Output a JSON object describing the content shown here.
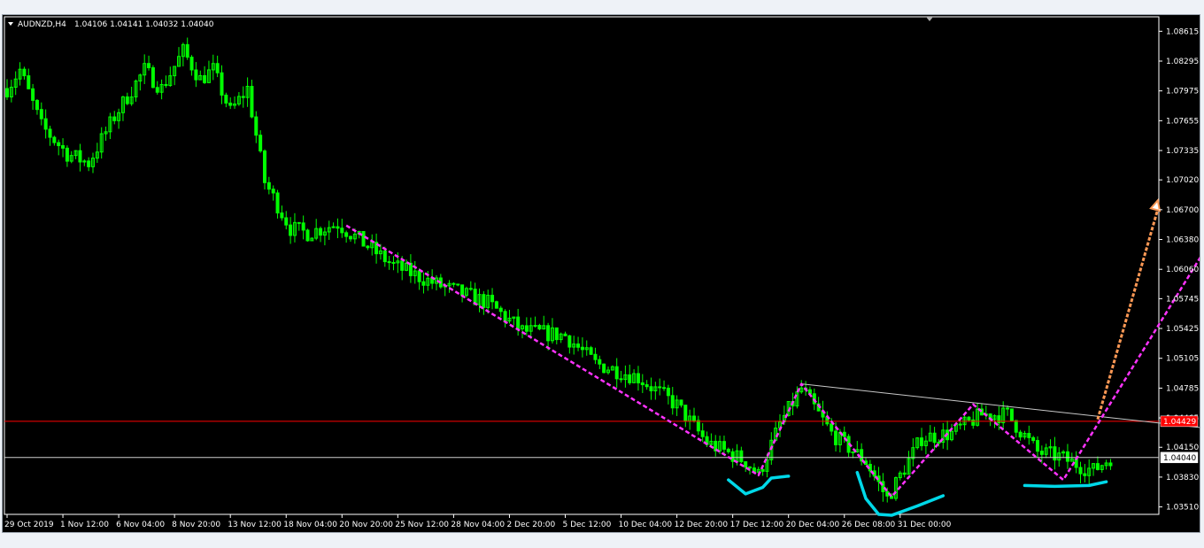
{
  "chart_data": {
    "type": "candlestick",
    "symbol_header": "AUDNZD,H4",
    "ohlc_header": "1.04106 1.04141 1.04032 1.04040",
    "y_ticks": [
      "1.08615",
      "1.08295",
      "1.07975",
      "1.07655",
      "1.07335",
      "1.07020",
      "1.06700",
      "1.06380",
      "1.06060",
      "1.05745",
      "1.05425",
      "1.05105",
      "1.04785",
      "1.04465",
      "1.04150",
      "1.03830",
      "1.03510"
    ],
    "ylim": [
      1.0343,
      1.0877
    ],
    "x_ticks": [
      "29 Oct 2019",
      "1 Nov 12:00",
      "6 Nov 04:00",
      "8 Nov 20:00",
      "13 Nov 12:00",
      "18 Nov 04:00",
      "20 Nov 20:00",
      "25 Nov 12:00",
      "28 Nov 04:00",
      "2 Dec 20:00",
      "5 Dec 12:00",
      "10 Dec 04:00",
      "12 Dec 20:00",
      "17 Dec 12:00",
      "20 Dec 04:00",
      "26 Dec 08:00",
      "31 Dec 00:00"
    ],
    "price_profile": [
      [
        0,
        1.08
      ],
      [
        3,
        1.082
      ],
      [
        8,
        1.076
      ],
      [
        14,
        1.073
      ],
      [
        19,
        1.072
      ],
      [
        25,
        1.077
      ],
      [
        32,
        1.082
      ],
      [
        36,
        1.08
      ],
      [
        41,
        1.084
      ],
      [
        45,
        1.081
      ],
      [
        48,
        1.082
      ],
      [
        52,
        1.0775
      ],
      [
        56,
        1.08
      ],
      [
        60,
        1.07
      ],
      [
        66,
        1.065
      ],
      [
        70,
        1.0645
      ],
      [
        77,
        1.0655
      ],
      [
        90,
        1.061
      ],
      [
        100,
        1.059
      ],
      [
        112,
        1.057
      ],
      [
        120,
        1.054
      ],
      [
        130,
        1.0535
      ],
      [
        137,
        1.0505
      ],
      [
        147,
        1.049
      ],
      [
        156,
        1.046
      ],
      [
        163,
        1.042
      ],
      [
        172,
        1.04
      ],
      [
        175,
        1.0385
      ],
      [
        180,
        1.044
      ],
      [
        185,
        1.0478
      ],
      [
        192,
        1.043
      ],
      [
        200,
        1.04
      ],
      [
        205,
        1.036
      ],
      [
        213,
        1.0425
      ],
      [
        220,
        1.043
      ],
      [
        227,
        1.045
      ],
      [
        233,
        1.045
      ],
      [
        240,
        1.041
      ],
      [
        245,
        1.0405
      ],
      [
        250,
        1.0395
      ],
      [
        253,
        1.039
      ],
      [
        257,
        1.0404
      ]
    ],
    "bars": 258,
    "current_price": 1.0404,
    "current_price_label": "1.04040",
    "red_level": 1.04429,
    "red_level_label": "1.04429",
    "colors": {
      "background": "#000000",
      "candles": "#00ff00",
      "text": "#ffffff",
      "red_line": "#ff0000",
      "white_line": "#c8c8c8",
      "annotation_magenta": "#ff33ff",
      "annotation_arrow": "#ff9955",
      "annotation_cyan": "#00d8e8"
    },
    "annotations": {
      "trendline": {
        "color": "#ffffff",
        "points": [
          [
            185,
            1.0483
          ],
          [
            310,
            1.042
          ]
        ]
      },
      "magenta_dashed": [
        [
          79,
          1.0653
        ],
        [
          175,
          1.0385
        ],
        [
          185,
          1.0483
        ],
        [
          206,
          1.0362
        ],
        [
          225,
          1.0461
        ],
        [
          246,
          1.038
        ],
        [
          279,
          1.0627
        ]
      ],
      "arrow": {
        "from": [
          254,
          1.0445
        ],
        "to": [
          268,
          1.068
        ]
      },
      "cyan_strokes": [
        [
          [
            168,
            1.038
          ],
          [
            172,
            1.0365
          ],
          [
            176,
            1.0372
          ],
          [
            178,
            1.0382
          ],
          [
            182,
            1.0384
          ]
        ],
        [
          [
            198,
            1.0388
          ],
          [
            200,
            1.036
          ],
          [
            203,
            1.0343
          ],
          [
            206,
            1.0342
          ],
          [
            212,
            1.0352
          ],
          [
            218,
            1.0363
          ]
        ],
        [
          [
            237,
            1.0374
          ],
          [
            244,
            1.0373
          ],
          [
            252,
            1.0374
          ],
          [
            256,
            1.0378
          ]
        ]
      ]
    }
  }
}
